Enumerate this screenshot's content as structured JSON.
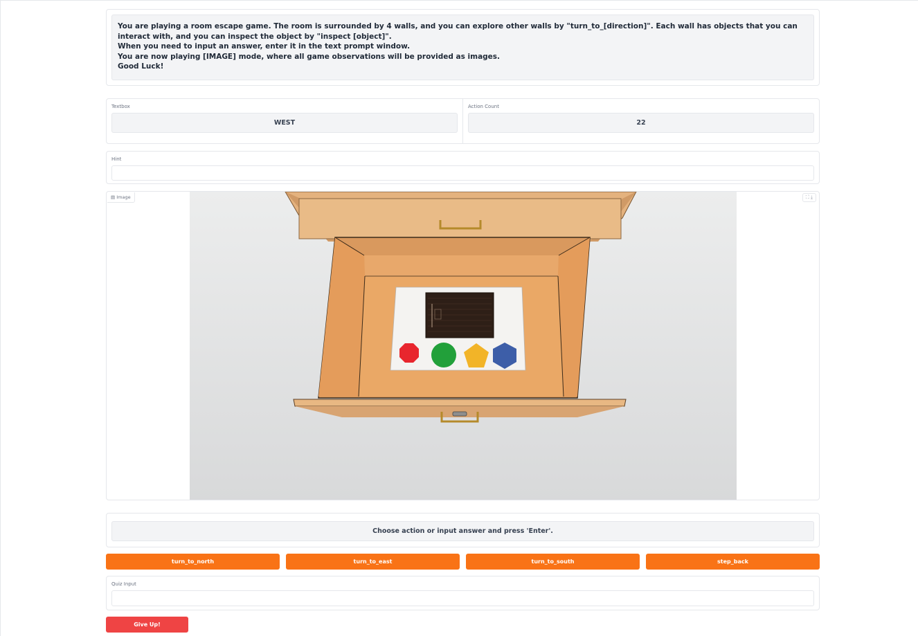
{
  "intro": {
    "line1": "You are playing a room escape game. The room is surrounded by 4 walls, and you can explore other walls by \"turn_to_[direction]\". Each wall has objects that you can interact with, and you can inspect the object by \"inspect [object]\".",
    "line2": "When you need to input an answer, enter it in the text prompt window.",
    "line3": "You are now playing [IMAGE] mode, where all game observations will be provided as images.",
    "line4": "Good Luck!"
  },
  "textbox": {
    "label": "Textbox",
    "value": "WEST"
  },
  "action_count": {
    "label": "Action Count",
    "value": "22"
  },
  "hint": {
    "label": "Hint",
    "value": ""
  },
  "image": {
    "label": "Image",
    "tools": "⛶ ⤓",
    "shapes": [
      {
        "name": "octagon",
        "color": "#e8262e"
      },
      {
        "name": "circle",
        "color": "#22a03a"
      },
      {
        "name": "pentagon",
        "color": "#f2b428"
      },
      {
        "name": "hexagon",
        "color": "#3d5ea8"
      }
    ],
    "wood_color": "#e4b27e",
    "drawer_inner_color": "#e69f63"
  },
  "prompt": {
    "text": "Choose action or input answer and press 'Enter'."
  },
  "actions": {
    "north": "turn_to_north",
    "east": "turn_to_east",
    "south": "turn_to_south",
    "back": "step_back"
  },
  "quiz": {
    "label": "Quiz Input",
    "value": ""
  },
  "give_up": {
    "label": "Give Up!"
  },
  "colors": {
    "action_button": "#f97316",
    "give_up_button": "#ef4444"
  }
}
